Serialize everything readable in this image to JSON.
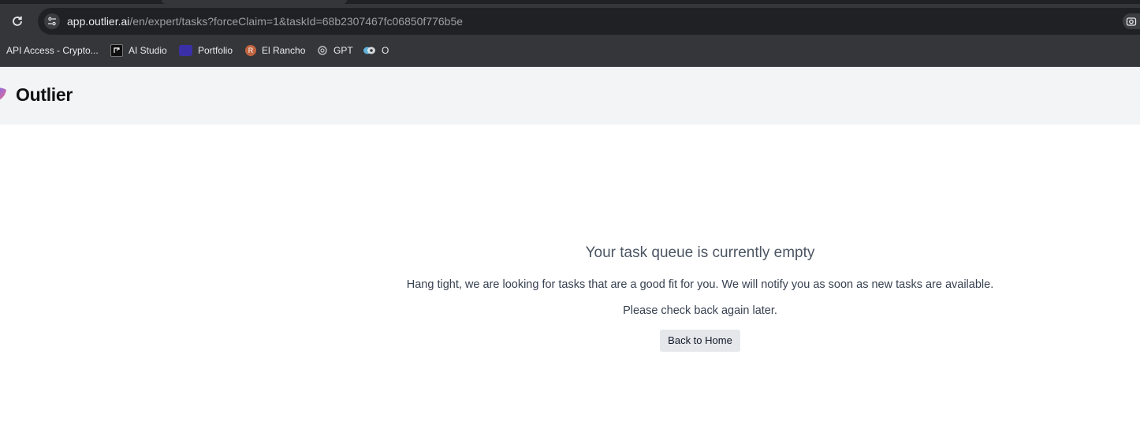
{
  "browser": {
    "url_host": "app.outlier.ai",
    "url_path": "/en/expert/tasks?forceClaim=1&taskId=68b2307467fc06850f776b5e",
    "bookmarks": [
      {
        "label": "API Access - Crypto...",
        "icon": "bookmark-favicon"
      },
      {
        "label": "AI Studio",
        "icon": "ai-studio-icon"
      },
      {
        "label": "Portfolio",
        "icon": "portfolio-icon"
      },
      {
        "label": "El Rancho",
        "icon": "el-rancho-icon"
      },
      {
        "label": "GPT",
        "icon": "openai-icon"
      },
      {
        "label": "O",
        "icon": "o-icon"
      }
    ]
  },
  "app": {
    "brand": "Outlier"
  },
  "empty_state": {
    "title": "Your task queue is currently empty",
    "message": "Hang tight, we are looking for tasks that are a good fit for you. We will notify you as soon as new tasks are available.",
    "hint": "Please check back again later.",
    "button_label": "Back to Home"
  },
  "colors": {
    "chrome_bg": "#35363a",
    "omnibox_bg": "#202124",
    "header_bg": "#f3f4f6",
    "button_bg": "#e5e7eb"
  }
}
